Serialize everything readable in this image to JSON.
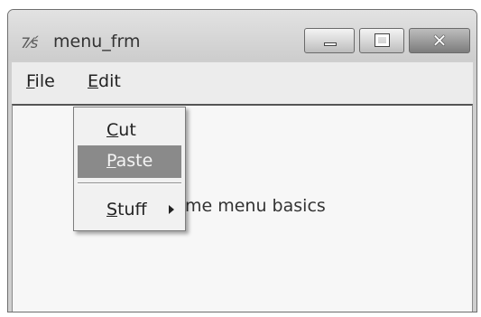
{
  "window": {
    "title": "menu_frm",
    "icon": "tk-feather-icon",
    "buttons": {
      "minimize": "minimize-icon",
      "maximize": "maximize-icon",
      "close": "close-icon"
    }
  },
  "menubar": {
    "items": [
      {
        "mnemonic": "F",
        "rest": "ile"
      },
      {
        "mnemonic": "E",
        "rest": "dit"
      }
    ]
  },
  "edit_menu": {
    "items": [
      {
        "mnemonic": "C",
        "rest": "ut"
      },
      {
        "mnemonic": "P",
        "rest": "aste"
      },
      {
        "mnemonic": "S",
        "rest": "tuff"
      }
    ],
    "highlighted": "Paste"
  },
  "content": {
    "visible_label_fragment": "me menu basics"
  }
}
